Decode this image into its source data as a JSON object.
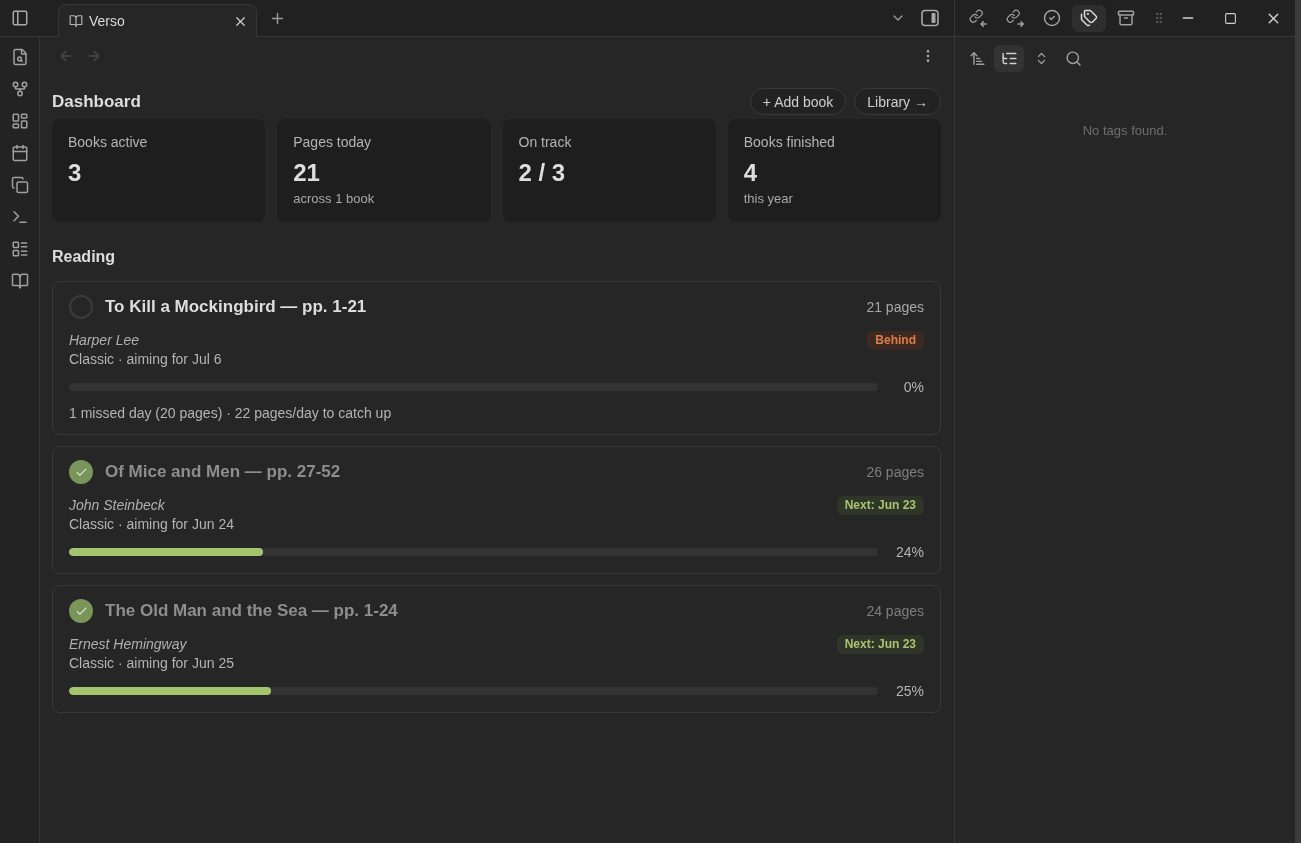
{
  "tab_bar": {
    "tabs": [
      {
        "label": "Verso",
        "selected": true
      }
    ]
  },
  "side_tabs": [
    {
      "selected": false
    },
    {
      "selected": false
    },
    {
      "selected": false
    },
    {
      "selected": true
    },
    {
      "selected": false
    }
  ],
  "navigation": [
    {
      "disabled": true
    },
    {
      "disabled": true
    }
  ],
  "dashboard": {
    "title": "Dashboard",
    "actions": [
      "+ Add book",
      "Library →"
    ],
    "stats": [
      {
        "label": "Books active",
        "value": "3"
      },
      {
        "label": "Pages today",
        "value": "21",
        "note": "across 1 book"
      },
      {
        "label": "On track",
        "value": "2 / 3"
      },
      {
        "label": "Books finished",
        "value": "4",
        "note": "this year"
      }
    ]
  },
  "reading": {
    "title": "Reading",
    "books": [
      {
        "title": "To Kill a Mockingbird — pp. 1-21",
        "done": false,
        "pages": "21 pages",
        "author": "Harper Lee",
        "status": {
          "kind": "behind",
          "label": "Behind"
        },
        "meta": "Classic · aiming for Jul 6",
        "level": 0,
        "percent": "0%",
        "note": "1 missed day (20 pages) · 22 pages/day to catch up"
      },
      {
        "title": "Of Mice and Men — pp. 27-52",
        "done": true,
        "pages": "26 pages",
        "author": "John Steinbeck",
        "status": {
          "kind": "next",
          "label": "Next: Jun 23"
        },
        "meta": "Classic · aiming for Jun 24",
        "level": 0.24,
        "percent": "24%"
      },
      {
        "title": "The Old Man and the Sea — pp. 1-24",
        "done": true,
        "pages": "24 pages",
        "author": "Ernest Hemingway",
        "status": {
          "kind": "next",
          "label": "Next: Jun 23"
        },
        "meta": "Classic · aiming for Jun 25",
        "level": 0.25,
        "percent": "25%"
      }
    ]
  },
  "tags_panel": {
    "tools": [
      {
        "on": false
      },
      {
        "on": true
      },
      {
        "on": false
      },
      {
        "on": false
      }
    ],
    "empty_message": "No tags found."
  }
}
